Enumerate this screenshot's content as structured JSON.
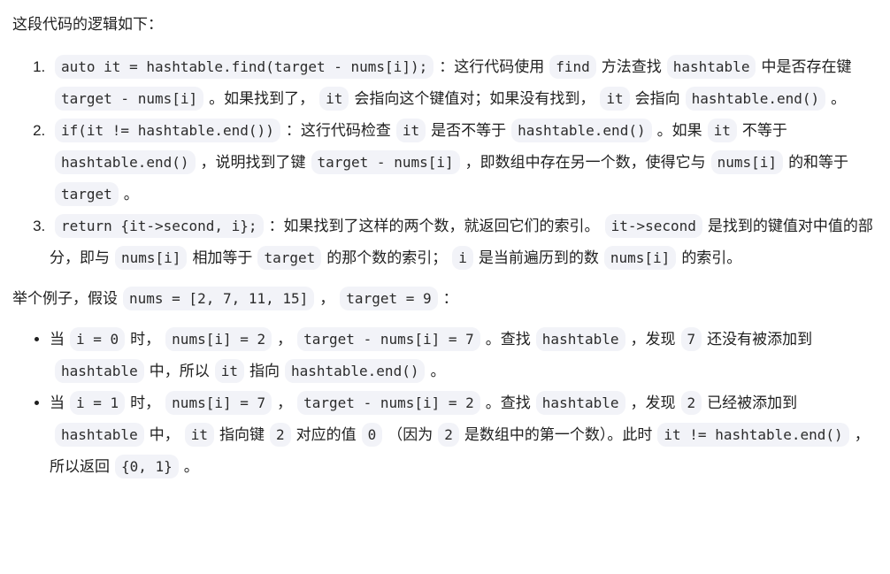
{
  "intro": "这段代码的逻辑如下：",
  "steps": [
    {
      "parts": [
        {
          "c": "auto it = hashtable.find(target - nums[i]);"
        },
        {
          "t": "：这行代码使用"
        },
        {
          "c": "find"
        },
        {
          "t": "方法查找"
        },
        {
          "c": "hashtable"
        },
        {
          "t": "中是否存在键"
        },
        {
          "c": "target - nums[i]"
        },
        {
          "t": "。如果找到了，"
        },
        {
          "c": "it"
        },
        {
          "t": "会指向这个键值对；如果没有找到，"
        },
        {
          "c": "it"
        },
        {
          "t": "会指向"
        },
        {
          "c": "hashtable.end()"
        },
        {
          "t": "。"
        }
      ]
    },
    {
      "parts": [
        {
          "c": "if(it != hashtable.end())"
        },
        {
          "t": "：这行代码检查"
        },
        {
          "c": "it"
        },
        {
          "t": "是否不等于"
        },
        {
          "c": "hashtable.end()"
        },
        {
          "t": "。如果"
        },
        {
          "c": "it"
        },
        {
          "t": "不等于"
        },
        {
          "c": "hashtable.end()"
        },
        {
          "t": "，说明找到了键"
        },
        {
          "c": "target - nums[i]"
        },
        {
          "t": "，即数组中存在另一个数，使得它与"
        },
        {
          "c": "nums[i]"
        },
        {
          "t": "的和等于"
        },
        {
          "c": "target"
        },
        {
          "t": "。"
        }
      ]
    },
    {
      "parts": [
        {
          "c": "return {it->second, i};"
        },
        {
          "t": "：如果找到了这样的两个数，就返回它们的索引。"
        },
        {
          "c": "it->second"
        },
        {
          "t": "是找到的键值对中值的部分，即与"
        },
        {
          "c": "nums[i]"
        },
        {
          "t": "相加等于"
        },
        {
          "c": "target"
        },
        {
          "t": "的那个数的索引；"
        },
        {
          "c": "i"
        },
        {
          "t": "是当前遍历到的数"
        },
        {
          "c": "nums[i]"
        },
        {
          "t": "的索引。"
        }
      ]
    }
  ],
  "example": {
    "parts": [
      {
        "t": "举个例子，假设"
      },
      {
        "c": "nums = [2, 7, 11, 15]"
      },
      {
        "t": "，"
      },
      {
        "c": "target = 9"
      },
      {
        "t": "："
      }
    ]
  },
  "cases": [
    {
      "parts": [
        {
          "t": "当"
        },
        {
          "c": "i = 0"
        },
        {
          "t": "时，"
        },
        {
          "c": "nums[i] = 2"
        },
        {
          "t": "，"
        },
        {
          "c": "target - nums[i] = 7"
        },
        {
          "t": "。查找"
        },
        {
          "c": "hashtable"
        },
        {
          "t": "，发现"
        },
        {
          "c": "7"
        },
        {
          "t": "还没有被添加到"
        },
        {
          "c": "hashtable"
        },
        {
          "t": "中，所以"
        },
        {
          "c": "it"
        },
        {
          "t": "指向"
        },
        {
          "c": "hashtable.end()"
        },
        {
          "t": "。"
        }
      ]
    },
    {
      "parts": [
        {
          "t": "当"
        },
        {
          "c": "i = 1"
        },
        {
          "t": "时，"
        },
        {
          "c": "nums[i] = 7"
        },
        {
          "t": "，"
        },
        {
          "c": "target - nums[i] = 2"
        },
        {
          "t": "。查找"
        },
        {
          "c": "hashtable"
        },
        {
          "t": "，发现"
        },
        {
          "c": "2"
        },
        {
          "t": "已经被添加到"
        },
        {
          "c": "hashtable"
        },
        {
          "t": "中，"
        },
        {
          "c": "it"
        },
        {
          "t": "指向键"
        },
        {
          "c": "2"
        },
        {
          "t": "对应的值"
        },
        {
          "c": "0"
        },
        {
          "t": "（因为"
        },
        {
          "c": "2"
        },
        {
          "t": "是数组中的第一个数）。此时"
        },
        {
          "c": "it != hashtable.end()"
        },
        {
          "t": "，所以返回"
        },
        {
          "c": "{0, 1}"
        },
        {
          "t": "。"
        }
      ]
    }
  ],
  "colors": {
    "code_bg": "#f2f3f8",
    "text": "#1f1f1f"
  }
}
